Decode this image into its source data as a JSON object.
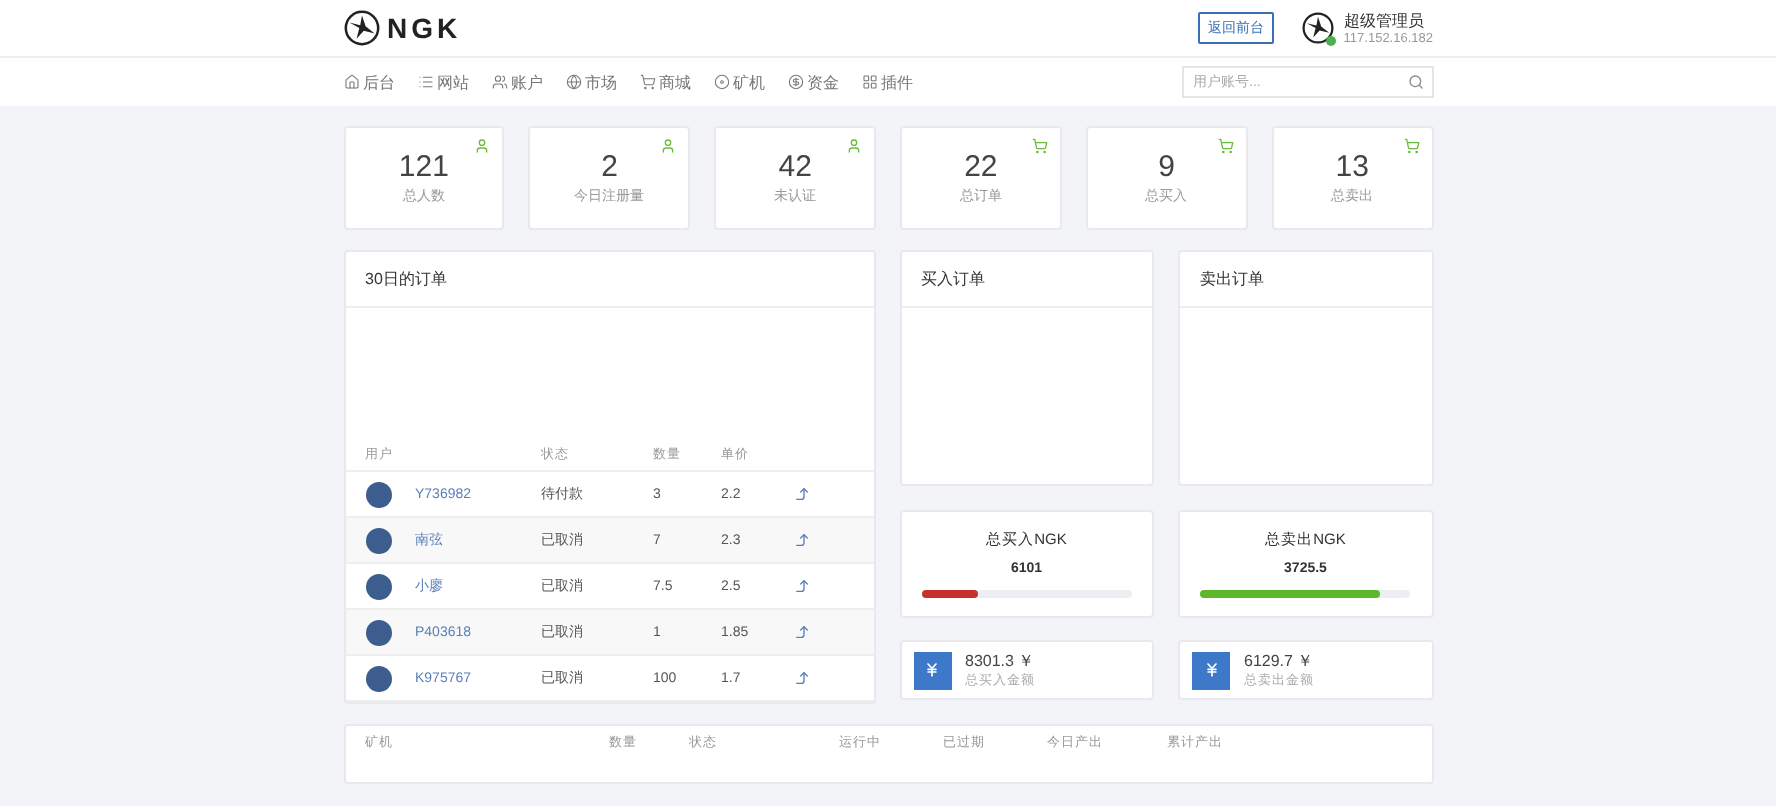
{
  "header": {
    "logo_text": "NGK",
    "back_button": "返回前台",
    "user": {
      "name": "超级管理员",
      "ip": "117.152.16.182",
      "online": true
    }
  },
  "nav": {
    "items": [
      {
        "kind": "home",
        "label": "后台"
      },
      {
        "kind": "list",
        "label": "网站"
      },
      {
        "kind": "users",
        "label": "账户"
      },
      {
        "kind": "globe",
        "label": "市场"
      },
      {
        "kind": "cart",
        "label": "商城"
      },
      {
        "kind": "disc",
        "label": "矿机"
      },
      {
        "kind": "coin",
        "label": "资金"
      },
      {
        "kind": "grid",
        "label": "插件"
      }
    ],
    "search": {
      "placeholder": "用户账号..."
    }
  },
  "stats": [
    {
      "kind": "user",
      "value": "121",
      "label": "总人数"
    },
    {
      "kind": "user",
      "value": "2",
      "label": "今日注册量"
    },
    {
      "kind": "user",
      "value": "42",
      "label": "未认证"
    },
    {
      "kind": "cart",
      "value": "22",
      "label": "总订单"
    },
    {
      "kind": "cart",
      "value": "9",
      "label": "总买入"
    },
    {
      "kind": "cart",
      "value": "13",
      "label": "总卖出"
    }
  ],
  "orders_card": {
    "title": "30日的订单",
    "columns": [
      "用户",
      "状态",
      "数量",
      "单价"
    ],
    "rows": [
      {
        "user": "Y736982",
        "status": "待付款",
        "quantity": "3",
        "price": "2.2"
      },
      {
        "user": "南弦",
        "status": "已取消",
        "quantity": "7",
        "price": "2.3"
      },
      {
        "user": "小廖",
        "status": "已取消",
        "quantity": "7.5",
        "price": "2.5"
      },
      {
        "user": "P403618",
        "status": "已取消",
        "quantity": "1",
        "price": "1.85"
      },
      {
        "user": "K975767",
        "status": "已取消",
        "quantity": "100",
        "price": "1.7"
      }
    ]
  },
  "buy_orders": {
    "title": "买入订单"
  },
  "sell_orders": {
    "title": "卖出订单"
  },
  "totals": [
    {
      "title": "总买入NGK",
      "value": "6101",
      "level": 0.27,
      "color": "#c9302c"
    },
    {
      "title": "总卖出NGK",
      "value": "3725.5",
      "level": 0.85,
      "color": "#5cb82a"
    }
  ],
  "amounts": [
    {
      "value": "8301.3 ￥",
      "label": "总买入金额"
    },
    {
      "value": "6129.7 ￥",
      "label": "总卖出金额"
    }
  ],
  "miners_card": {
    "columns": [
      "矿机",
      "数量",
      "状态",
      "运行中",
      "已过期",
      "今日产出",
      "累计产出"
    ]
  }
}
